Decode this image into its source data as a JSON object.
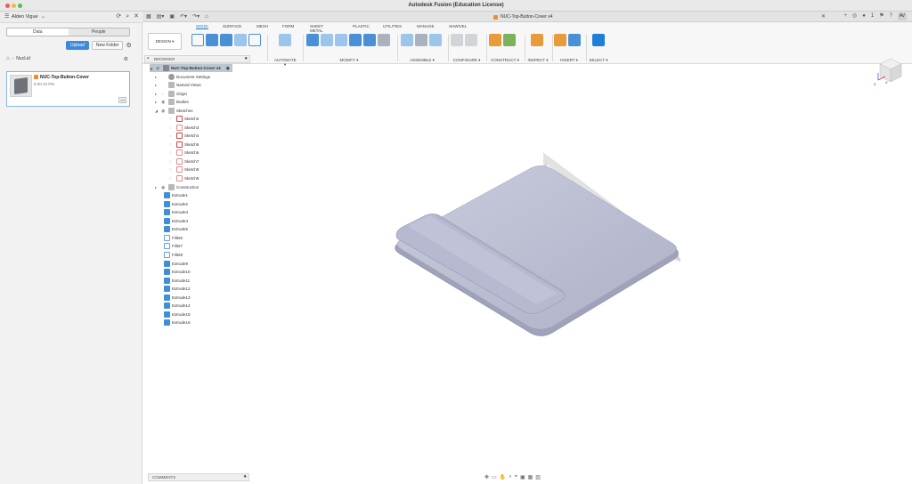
{
  "window": {
    "title": "Autodesk Fusion (Education License)"
  },
  "data_panel": {
    "user_name": "Alden Vigue",
    "tabs": [
      {
        "label": "Data"
      },
      {
        "label": "People"
      }
    ],
    "upload_label": "Upload",
    "new_folder_label": "New Folder",
    "breadcrumb": "NucLid",
    "file": {
      "name": "NUC-Top-Button-Cover",
      "time": "5:00:10 PM",
      "version": "V4"
    }
  },
  "doc_tab": {
    "title": "NUC-Top-Button-Cover v4"
  },
  "header_right": {
    "notifications": "1",
    "avatar": "AV"
  },
  "toolbar": {
    "design_label": "DESIGN ▾",
    "workspace_tabs": [
      "SOLID",
      "SURFACE",
      "MESH",
      "FORM",
      "SHEET METAL",
      "PLASTIC",
      "UTILITIES",
      "MANAGE",
      "SHWIVEL"
    ],
    "groups": {
      "create": "CREATE ▾",
      "automate": "AUTOMATE ▾",
      "modify": "MODIFY ▾",
      "assemble": "ASSEMBLE ▾",
      "configure": "CONFIGURE ▾",
      "construct": "CONSTRUCT ▾",
      "inspect": "INSPECT ▾",
      "insert": "INSERT ▾",
      "select": "SELECT ▾"
    }
  },
  "browser": {
    "title": "BROWSER",
    "root": "NUC-Top-Button-Cover v4",
    "top_items": [
      "Document Settings",
      "Named Views",
      "Origin",
      "Bodies",
      "Sketches"
    ],
    "sketches": [
      "Sketch2",
      "Sketch3",
      "Sketch4",
      "Sketch5",
      "Sketch6",
      "Sketch7",
      "Sketch8",
      "Sketch9"
    ],
    "construction": "Construction",
    "timeline": [
      "Extrude1",
      "Extrude2",
      "Extrude3",
      "Extrude4",
      "Extrude5",
      "Fillet6",
      "Fillet7",
      "Fillet8",
      "Extrude9",
      "Extrude10",
      "Extrude11",
      "Extrude12",
      "Extrude13",
      "Extrude14",
      "Extrude15",
      "Extrude16"
    ]
  },
  "viewcube": {
    "axis_x": "X",
    "axis_z": "Z"
  },
  "comments": {
    "label": "COMMENTS"
  }
}
